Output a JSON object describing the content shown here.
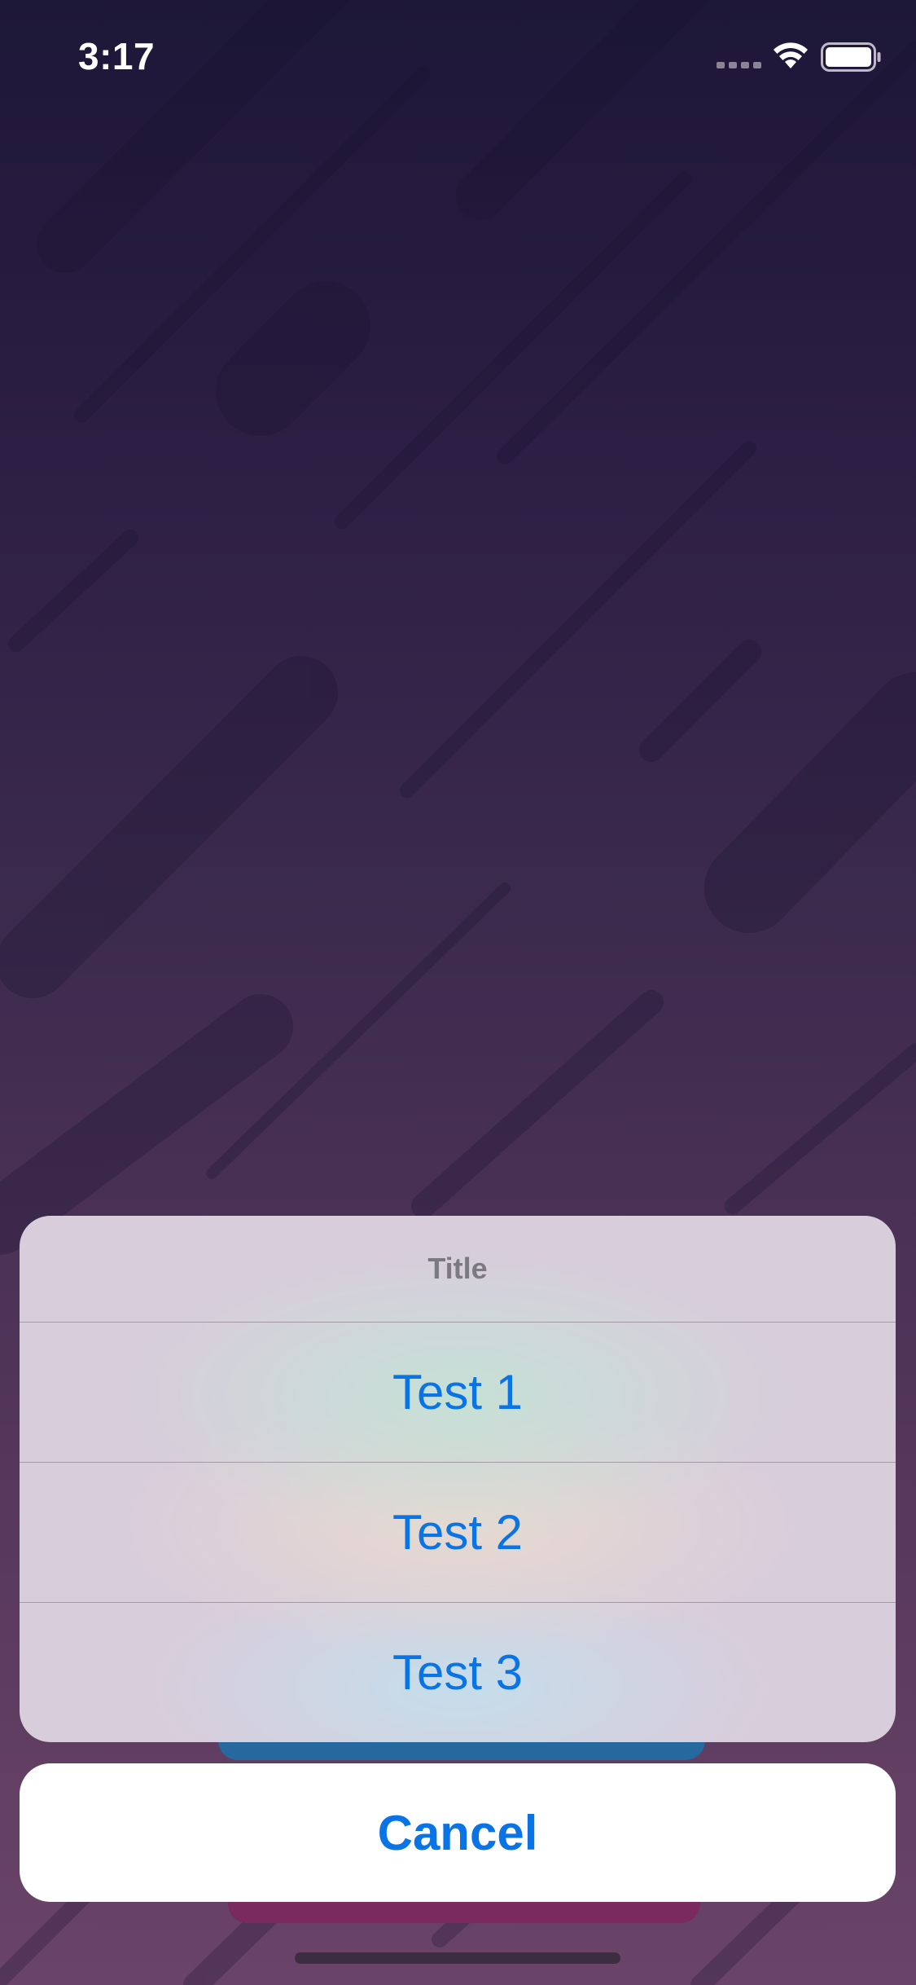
{
  "status_bar": {
    "time": "3:17",
    "icons": [
      "cellular-signal-icon",
      "wifi-icon",
      "battery-icon"
    ]
  },
  "action_sheet": {
    "title": "Title",
    "actions": [
      {
        "label": "Test 1"
      },
      {
        "label": "Test 2"
      },
      {
        "label": "Test 3"
      }
    ],
    "cancel_label": "Cancel"
  },
  "colors": {
    "action_blue": "#0a74e6",
    "title_gray": "#7b7a80",
    "background_top": "#1d1738",
    "background_bottom": "#6a4468"
  }
}
